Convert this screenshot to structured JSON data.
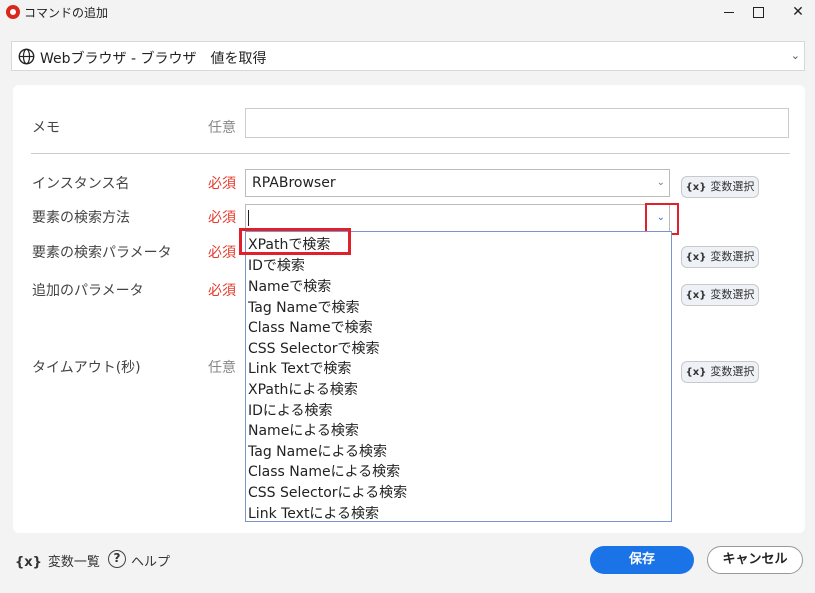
{
  "window": {
    "title": "コマンドの追加"
  },
  "command": {
    "label": "Webブラウザ - ブラウザ　値を取得"
  },
  "form": {
    "memo": {
      "label": "メモ",
      "badge": "任意"
    },
    "instance": {
      "label": "インスタンス名",
      "badge": "必須",
      "value": "RPABrowser",
      "var_button": "変数選択"
    },
    "search_method": {
      "label": "要素の検索方法",
      "badge": "必須",
      "value": ""
    },
    "search_param": {
      "label": "要素の検索パラメータ",
      "badge": "必須",
      "var_button": "変数選択"
    },
    "extra_param": {
      "label": "追加のパラメータ",
      "badge": "必須",
      "var_button": "変数選択"
    },
    "timeout": {
      "label": "タイムアウト(秒)",
      "badge": "任意",
      "var_button": "変数選択"
    }
  },
  "var_icon": "{x}",
  "dropdown_options": [
    "XPathで検索",
    "IDで検索",
    "Nameで検索",
    "Tag Nameで検索",
    "Class Nameで検索",
    "CSS Selectorで検索",
    "Link Textで検索",
    "XPathによる検索",
    "IDによる検索",
    "Nameによる検索",
    "Tag Nameによる検索",
    "Class Nameによる検索",
    "CSS Selectorによる検索",
    "Link Textによる検索"
  ],
  "footer": {
    "var_list": "変数一覧",
    "help": "ヘルプ",
    "help_icon": "?",
    "save": "保存",
    "cancel": "キャンセル"
  },
  "colors": {
    "required": "#e53a2c",
    "primary": "#1b73e8",
    "highlight": "#e0202a"
  }
}
